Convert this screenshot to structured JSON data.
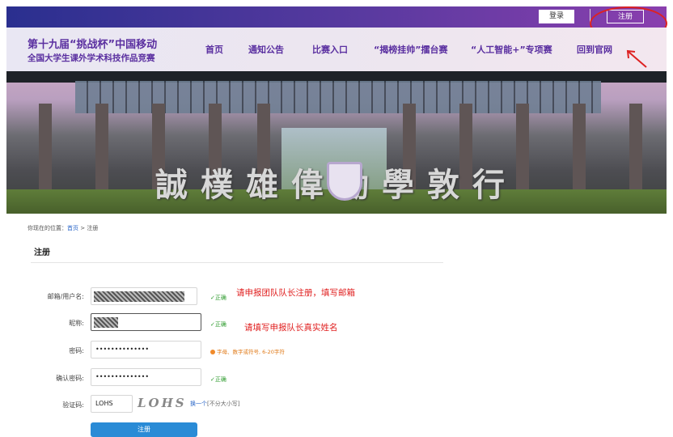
{
  "header": {
    "login_label": "登录",
    "register_label": "注册"
  },
  "brand": {
    "line1": "第十九届“挑战杯”中国移动",
    "line2": "全国大学生课外学术科技作品竞赛"
  },
  "nav": {
    "items": [
      "首页",
      "通知公告",
      "比赛入口",
      "“揭榜挂帅”擂台赛",
      "“人工智能+”专项赛",
      "回到官网"
    ]
  },
  "banner": {
    "motto": "誠樸雄偉勵學敦行"
  },
  "breadcrumb": {
    "prefix": "你现在的位置：",
    "home": "首页",
    "separator": " > ",
    "current": "注册"
  },
  "form": {
    "title": "注册",
    "email_label": "邮箱/用户名:",
    "nickname_label": "昵称:",
    "password_label": "密码:",
    "password_value": "••••••••••••••",
    "confirm_label": "确认密码:",
    "confirm_value": "••••••••••••••",
    "captcha_label": "验证码:",
    "captcha_value": "LOHS",
    "captcha_image_text": "LOHS",
    "captcha_refresh": "换一个",
    "captcha_note": "[不分大小写]",
    "ok_text": "✓正确",
    "password_hint": "字母、数字或符号, 6-20字符",
    "submit_label": "注册"
  },
  "annotations": {
    "email_note": "请申报团队队长注册，填写邮箱",
    "nickname_note": "请填写申报队长真实姓名"
  },
  "colors": {
    "brand_purple": "#5a2fa0",
    "annotation_red": "#e02020",
    "ok_green": "#2e9b2e",
    "hint_orange": "#e07a18",
    "button_blue": "#2a8bd6"
  }
}
